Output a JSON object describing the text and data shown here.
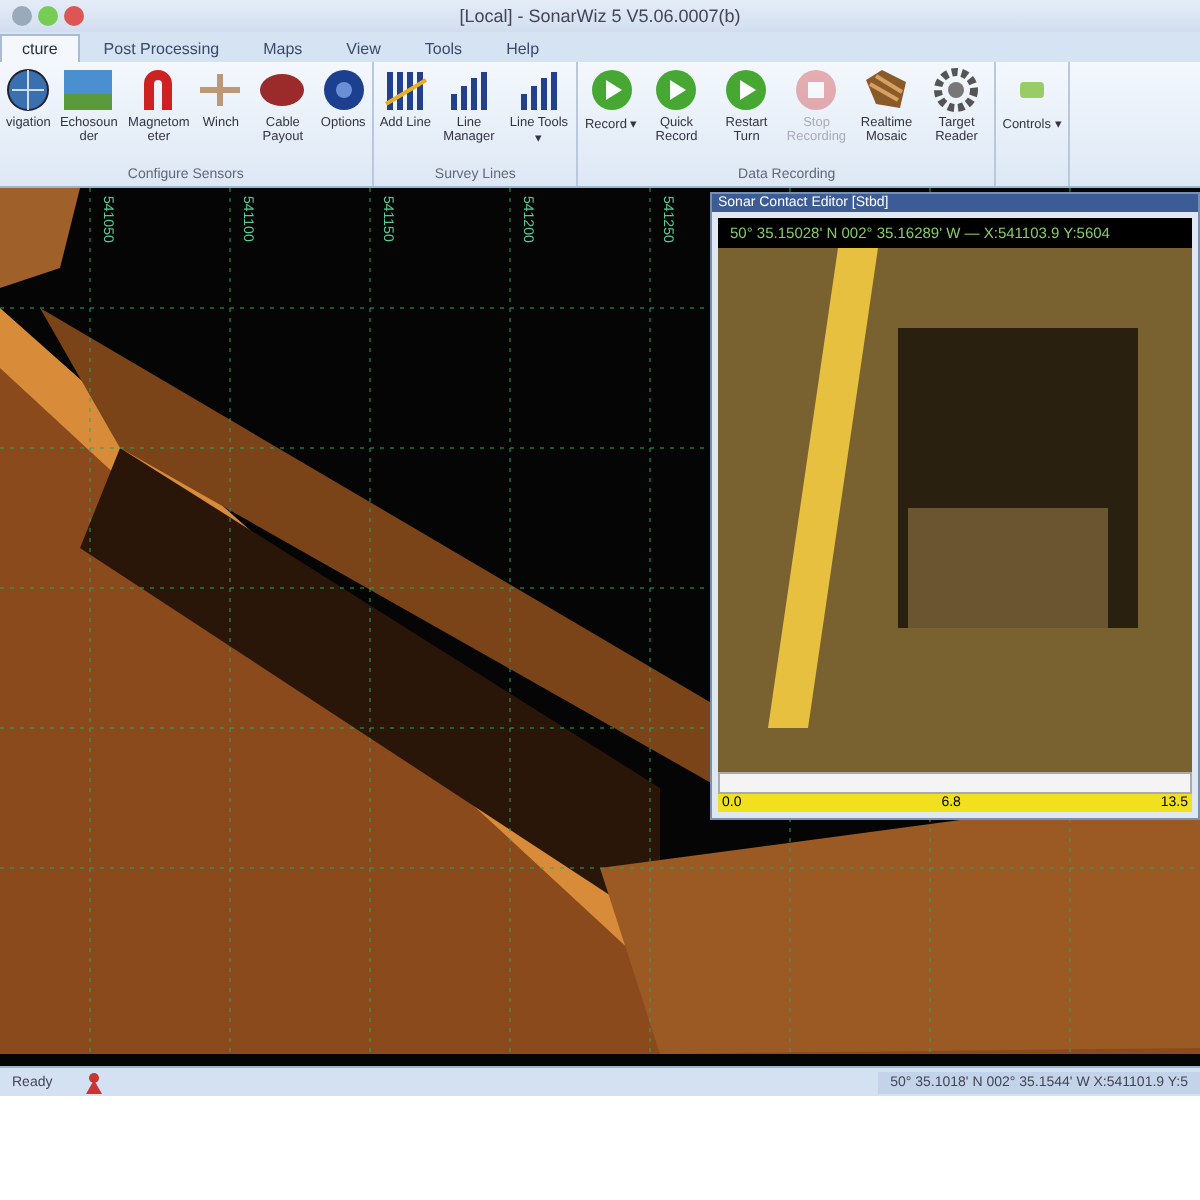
{
  "window": {
    "title": "[Local] - SonarWiz 5 V5.06.0007(b)"
  },
  "tabs": [
    {
      "label": "cture",
      "selected": true
    },
    {
      "label": "Post Processing",
      "selected": false
    },
    {
      "label": "Maps",
      "selected": false
    },
    {
      "label": "View",
      "selected": false
    },
    {
      "label": "Tools",
      "selected": false
    },
    {
      "label": "Help",
      "selected": false
    }
  ],
  "ribbon_groups": [
    {
      "label": "Configure Sensors",
      "buttons": [
        {
          "label": "vigation",
          "disabled": false
        },
        {
          "label": "Echosounder",
          "disabled": false
        },
        {
          "label": "Magnetometer",
          "disabled": false
        },
        {
          "label": "Winch",
          "disabled": false
        },
        {
          "label": "Cable Payout",
          "disabled": false
        },
        {
          "label": "Options",
          "disabled": false
        }
      ]
    },
    {
      "label": "Survey Lines",
      "buttons": [
        {
          "label": "Add Line",
          "disabled": false
        },
        {
          "label": "Line Manager",
          "disabled": false
        },
        {
          "label": "Line Tools ▾",
          "disabled": false
        }
      ]
    },
    {
      "label": "Data Recording",
      "buttons": [
        {
          "label": "Record ▾",
          "disabled": false
        },
        {
          "label": "Quick Record",
          "disabled": false
        },
        {
          "label": "Restart Turn",
          "disabled": false
        },
        {
          "label": "Stop Recording",
          "disabled": true
        },
        {
          "label": "Realtime Mosaic",
          "disabled": false
        },
        {
          "label": "Target Reader",
          "disabled": false
        }
      ]
    },
    {
      "buttons": [
        {
          "label": "Controls ▾",
          "disabled": false
        }
      ]
    }
  ],
  "map": {
    "grid_labels": [
      "541050",
      "541100",
      "541150",
      "541200",
      "541250"
    ]
  },
  "contact_window": {
    "title": "Sonar Contact Editor [Stbd]",
    "coordinates": "50° 35.15028' N 002° 35.16289' W — X:541103.9 Y:5604",
    "ruler": [
      "0.0",
      "6.8",
      "13.5"
    ]
  },
  "status_bar": {
    "left": "Ready",
    "right": "50° 35.1018' N 002° 35.1544' W    X:541101.9 Y:5"
  }
}
